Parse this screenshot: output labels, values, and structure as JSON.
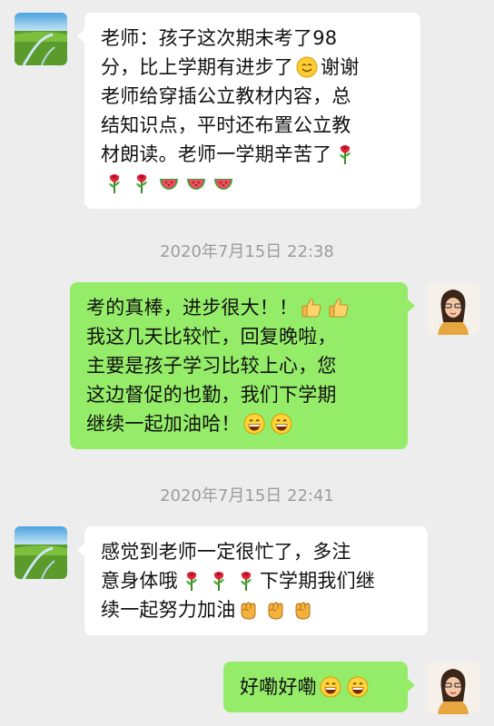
{
  "chat": {
    "messages": [
      {
        "side": "in",
        "lines": [
          "老师：孩子这次期末考了98",
          "分，比上学期有进步了",
          "谢谢",
          "老师给穿插公立教材内容，总",
          "结知识点，平时还布置公立教",
          "材朗读。老师一学期辛苦了"
        ],
        "emojis": [
          "smile-emoji",
          "rose-emoji",
          "watermelon-emoji"
        ]
      },
      {
        "side": "out",
        "lines": [
          "考的真棒，进步很大！！",
          "我这几天比较忙，回复晚啦，",
          "主要是孩子学习比较上心，您",
          "这边督促的也勤，我们下学期",
          "继续一起加油哈！"
        ],
        "emojis": [
          "thumbs-up-emoji",
          "grin-emoji"
        ]
      },
      {
        "side": "in",
        "lines": [
          "感觉到老师一定很忙了，多注",
          "意身体哦",
          "下学期我们继",
          "续一起努力加油"
        ],
        "emojis": [
          "rose-emoji",
          "fist-emoji"
        ]
      },
      {
        "side": "out",
        "lines": [
          "好嘞好嘞"
        ],
        "emojis": [
          "grin-emoji"
        ]
      }
    ],
    "timestamps": [
      "2020年7月15日 22:38",
      "2020年7月15日 22:41"
    ]
  },
  "avatars": {
    "teacher": "landscape-avatar",
    "parent": "woman-portrait-avatar"
  },
  "colors": {
    "background": "#ededed",
    "incoming_bubble": "#ffffff",
    "outgoing_bubble": "#95ec69",
    "timestamp_text": "#9c9c9c"
  }
}
